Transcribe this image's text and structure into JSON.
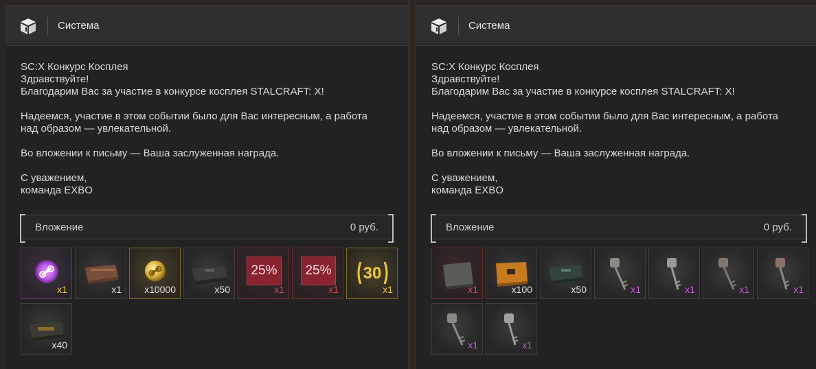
{
  "panels": [
    {
      "header_title": "Система",
      "header_icon": "box-icon",
      "message": {
        "line1": "SC:X Конкурс Косплея",
        "line2": "Здравствуйте!",
        "line3": "Благодарим Вас за участие в конкурсе косплея STALCRAFT: X!",
        "line4": "Надеемся, участие в этом событии было для Вас интересным, а работа",
        "line5": "над образом — увлекательной.",
        "line6": "Во вложении к письму — Ваша заслуженная награда.",
        "line7": "С уважением,",
        "line8": "команда EXBO"
      },
      "attachment": {
        "label": "Вложение",
        "price": "0 руб."
      },
      "items": [
        {
          "icon": "purple-chain-coin-icon",
          "qty": "x1",
          "qty_color": "#f2c83a"
        },
        {
          "icon": "wooden-crate-icon",
          "qty": "x1",
          "qty_color": "#e0e0e0"
        },
        {
          "icon": "gold-chain-coin-icon",
          "qty": "x10000",
          "qty_color": "#e0e0e0"
        },
        {
          "icon": "dark-case-icon",
          "qty": "x50",
          "qty_color": "#e0e0e0"
        },
        {
          "icon": "discount-coupon-icon",
          "label": "25%",
          "qty": "x1",
          "qty_color": "#e2474a"
        },
        {
          "icon": "discount-coupon-icon",
          "label": "25%",
          "qty": "x1",
          "qty_color": "#e2474a"
        },
        {
          "icon": "30-days-badge-icon",
          "label": "30",
          "qty": "x1",
          "qty_color": "#f2c83a"
        },
        {
          "icon": "military-case-icon",
          "qty": "x40",
          "qty_color": "#e0e0e0"
        }
      ]
    },
    {
      "header_title": "Система",
      "header_icon": "box-icon",
      "message": {
        "line1": "SC:X Конкурс Косплея",
        "line2": "Здравствуйте!",
        "line3": "Благодарим Вас за участие в конкурсе косплея STALCRAFT: X!",
        "line4": "Надеемся, участие в этом событии было для Вас интересным, а работа",
        "line5": "над образом — увлекательной.",
        "line6": "Во вложении к письму — Ваша заслуженная награда.",
        "line7": "С уважением,",
        "line8": "команда EXBO"
      },
      "attachment": {
        "label": "Вложение",
        "price": "0 руб."
      },
      "items": [
        {
          "icon": "armor-plate-icon",
          "qty": "x1",
          "qty_color": "#e2474a"
        },
        {
          "icon": "orange-crate-icon",
          "qty": "x100",
          "qty_color": "#e0e0e0"
        },
        {
          "icon": "teal-case-icon",
          "qty": "x50",
          "qty_color": "#e0e0e0"
        },
        {
          "icon": "key-icon",
          "qty": "x1",
          "qty_color": "#c45cd6"
        },
        {
          "icon": "key-icon",
          "qty": "x1",
          "qty_color": "#c45cd6"
        },
        {
          "icon": "key-icon",
          "qty": "x1",
          "qty_color": "#c45cd6"
        },
        {
          "icon": "key-icon",
          "qty": "x1",
          "qty_color": "#c45cd6"
        },
        {
          "icon": "key-icon",
          "qty": "x1",
          "qty_color": "#c45cd6"
        },
        {
          "icon": "key-icon",
          "qty": "x1",
          "qty_color": "#c45cd6"
        }
      ]
    }
  ]
}
